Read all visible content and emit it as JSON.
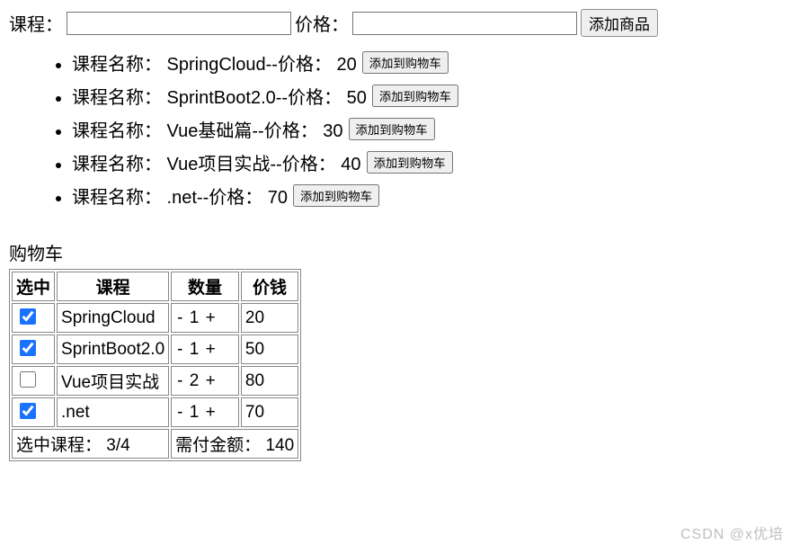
{
  "form": {
    "courseLabel": "课程：",
    "priceLabel": "价格：",
    "addButton": "添加商品"
  },
  "listText": {
    "namePrefix": "课程名称：",
    "priceLabel": "--价格：",
    "addToCart": "添加到购物车"
  },
  "courses": [
    {
      "name": "SpringCloud",
      "price": 20
    },
    {
      "name": "SprintBoot2.0",
      "price": 50
    },
    {
      "name": "Vue基础篇",
      "price": 30
    },
    {
      "name": "Vue项目实战",
      "price": 40
    },
    {
      "name": ".net",
      "price": 70
    }
  ],
  "cart": {
    "title": "购物车",
    "headers": {
      "sel": "选中",
      "name": "课程",
      "qty": "数量",
      "price": "价钱"
    },
    "items": [
      {
        "sel": true,
        "name": "SpringCloud",
        "qty": 1,
        "price": 20
      },
      {
        "sel": true,
        "name": "SprintBoot2.0",
        "qty": 1,
        "price": 50
      },
      {
        "sel": false,
        "name": "Vue项目实战",
        "qty": 2,
        "price": 80
      },
      {
        "sel": true,
        "name": ".net",
        "qty": 1,
        "price": 70
      }
    ],
    "summary": {
      "selLabel": "选中课程：",
      "selValue": "3/4",
      "totalLabel": "需付金额：",
      "totalValue": 140
    }
  },
  "watermark": "CSDN @x优培"
}
